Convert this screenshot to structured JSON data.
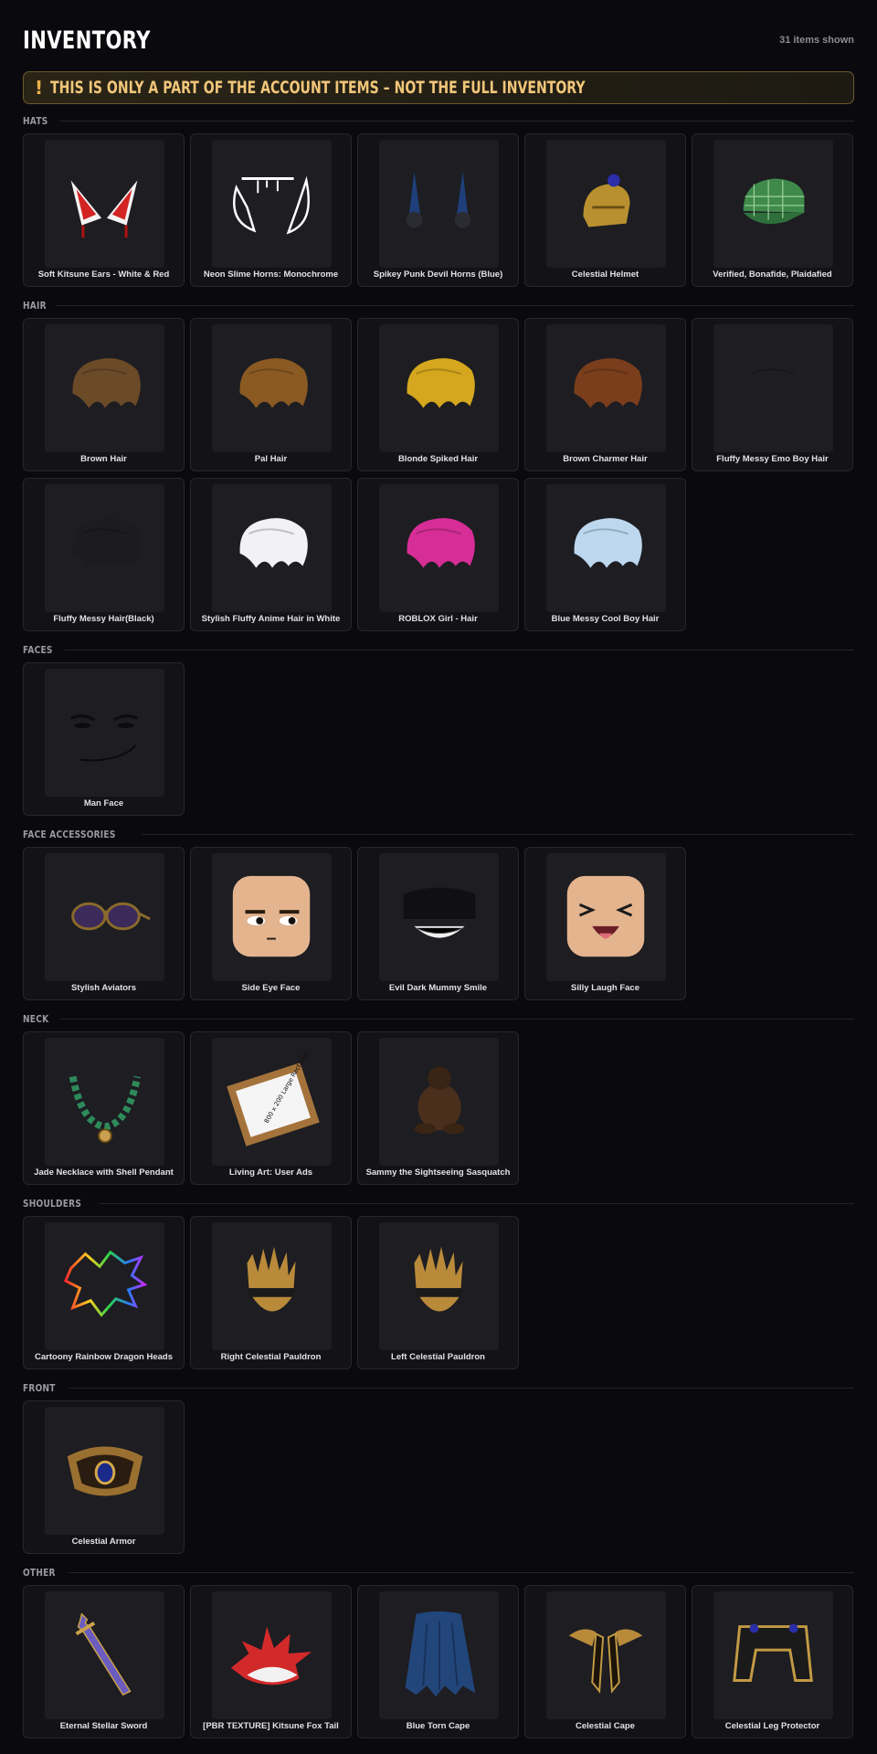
{
  "header": {
    "title": "INVENTORY",
    "count": "31 items shown"
  },
  "banner": {
    "icon": "exclamation-icon",
    "text": "THIS IS ONLY A PART OF THE ACCOUNT ITEMS – NOT THE FULL INVENTORY"
  },
  "sections": [
    {
      "label": "HATS",
      "items": [
        {
          "name": "Soft Kitsune Ears - White & Red",
          "icon": "kitsune-ears"
        },
        {
          "name": "Neon Slime Horns: Monochrome",
          "icon": "slime-horns"
        },
        {
          "name": "Spikey Punk Devil Horns (Blue)",
          "icon": "devil-horns"
        },
        {
          "name": "Celestial Helmet",
          "icon": "helmet"
        },
        {
          "name": "Verified, Bonafide, Plaidafied",
          "icon": "plaid-cap"
        }
      ]
    },
    {
      "label": "HAIR",
      "items": [
        {
          "name": "Brown Hair",
          "icon": "hair",
          "color": "#6b4a28"
        },
        {
          "name": "Pal Hair",
          "icon": "hair",
          "color": "#8a5a22"
        },
        {
          "name": "Blonde Spiked Hair",
          "icon": "hair",
          "color": "#d4a71e"
        },
        {
          "name": "Brown Charmer Hair",
          "icon": "hair",
          "color": "#7a3e1c"
        },
        {
          "name": "Fluffy Messy Emo Boy Hair",
          "icon": "hair",
          "color": "#1f1f22"
        },
        {
          "name": "Fluffy Messy Hair(Black)",
          "icon": "hair",
          "color": "#1c1c1f"
        },
        {
          "name": "Stylish Fluffy Anime Hair in White",
          "icon": "hair",
          "color": "#f2f2f4"
        },
        {
          "name": "ROBLOX Girl - Hair",
          "icon": "hair",
          "color": "#d62e96"
        },
        {
          "name": "Blue Messy Cool Boy Hair",
          "icon": "hair",
          "color": "#bcd7ee"
        }
      ]
    },
    {
      "label": "FACES",
      "items": [
        {
          "name": "Man Face",
          "icon": "man-face"
        }
      ]
    },
    {
      "label": "FACE ACCESSORIES",
      "items": [
        {
          "name": "Stylish Aviators",
          "icon": "aviators"
        },
        {
          "name": "Side Eye Face",
          "icon": "side-eye-face"
        },
        {
          "name": "Evil Dark Mummy Smile",
          "icon": "mummy-smile"
        },
        {
          "name": "Silly Laugh Face",
          "icon": "laugh-face"
        }
      ]
    },
    {
      "label": "NECK",
      "items": [
        {
          "name": "Jade Necklace with Shell Pendant",
          "icon": "necklace"
        },
        {
          "name": "Living Art: User Ads",
          "icon": "frame-art",
          "caption": "800 x 200 Large Rectangle"
        },
        {
          "name": "Sammy the Sightseeing Sasquatch",
          "icon": "sasquatch"
        }
      ]
    },
    {
      "label": "SHOULDERS",
      "items": [
        {
          "name": "Cartoony Rainbow Dragon Heads",
          "icon": "rainbow-dragon"
        },
        {
          "name": "Right Celestial Pauldron",
          "icon": "pauldron"
        },
        {
          "name": "Left Celestial Pauldron",
          "icon": "pauldron"
        }
      ]
    },
    {
      "label": "FRONT",
      "items": [
        {
          "name": "Celestial Armor",
          "icon": "armor"
        }
      ]
    },
    {
      "label": "OTHER",
      "items": [
        {
          "name": "Eternal Stellar Sword",
          "icon": "sword"
        },
        {
          "name": "[PBR TEXTURE] Kitsune Fox Tail",
          "icon": "fox-tail"
        },
        {
          "name": "Blue Torn Cape",
          "icon": "torn-cape"
        },
        {
          "name": "Celestial Cape",
          "icon": "celestial-cape"
        },
        {
          "name": "Celestial Leg Protector",
          "icon": "leg-protector"
        }
      ]
    }
  ]
}
